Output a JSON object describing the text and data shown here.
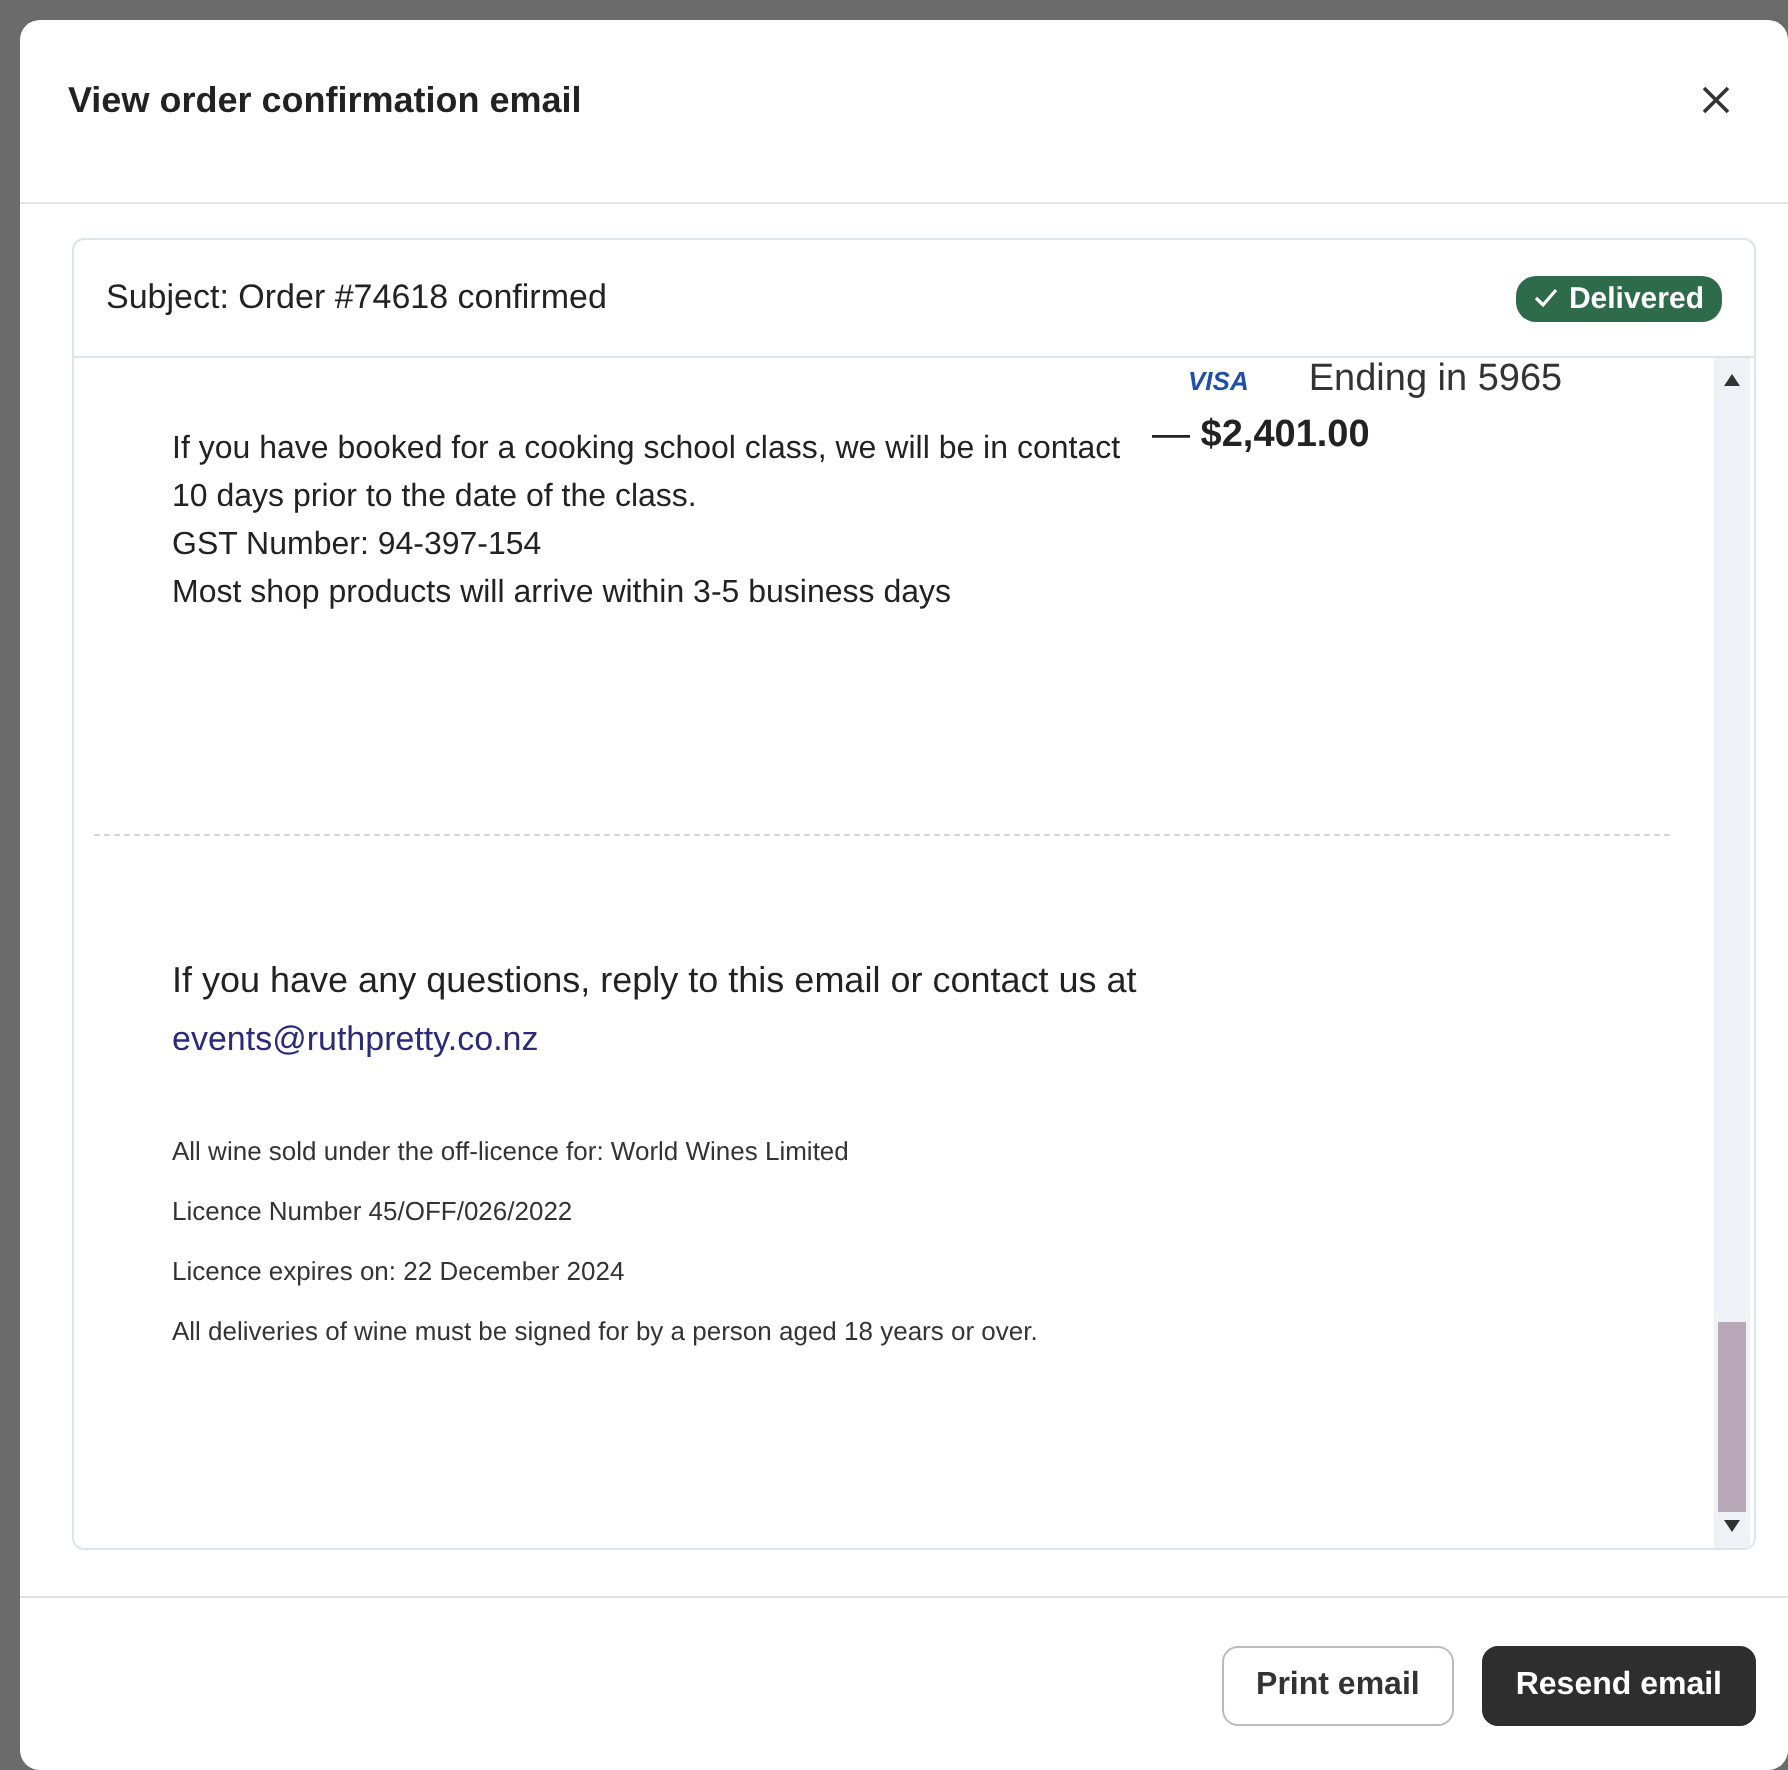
{
  "dialog": {
    "title": "View order confirmation email"
  },
  "email": {
    "subject": "Subject: Order #74618 confirmed",
    "status": {
      "label": "Delivered",
      "kind": "delivered"
    },
    "payment": {
      "brand": "VISA",
      "card": "Ending in 5965",
      "amount": "— **$2,401.00**"
    },
    "notes": [
      "If you have booked for a cooking school class, we will be in contact 10 days prior to the date of the class.",
      "GST Number: 94-397-154",
      "Most shop products will arrive within 3-5 business days"
    ],
    "contact": {
      "text": "If you have any questions, reply to this email or contact us at",
      "link": "events@ruthpretty.co.nz"
    },
    "legal": [
      "All wine sold under the off-licence for: World Wines Limited",
      "Licence Number 45/OFF/026/2022",
      "Licence expires on: 22 December 2024",
      "All deliveries of wine must be signed for by a person aged 18 years or over."
    ]
  },
  "buttons": [
    {
      "label": "Print email",
      "kind": "secondary"
    },
    {
      "label": "Resend email",
      "kind": "primary"
    }
  ]
}
